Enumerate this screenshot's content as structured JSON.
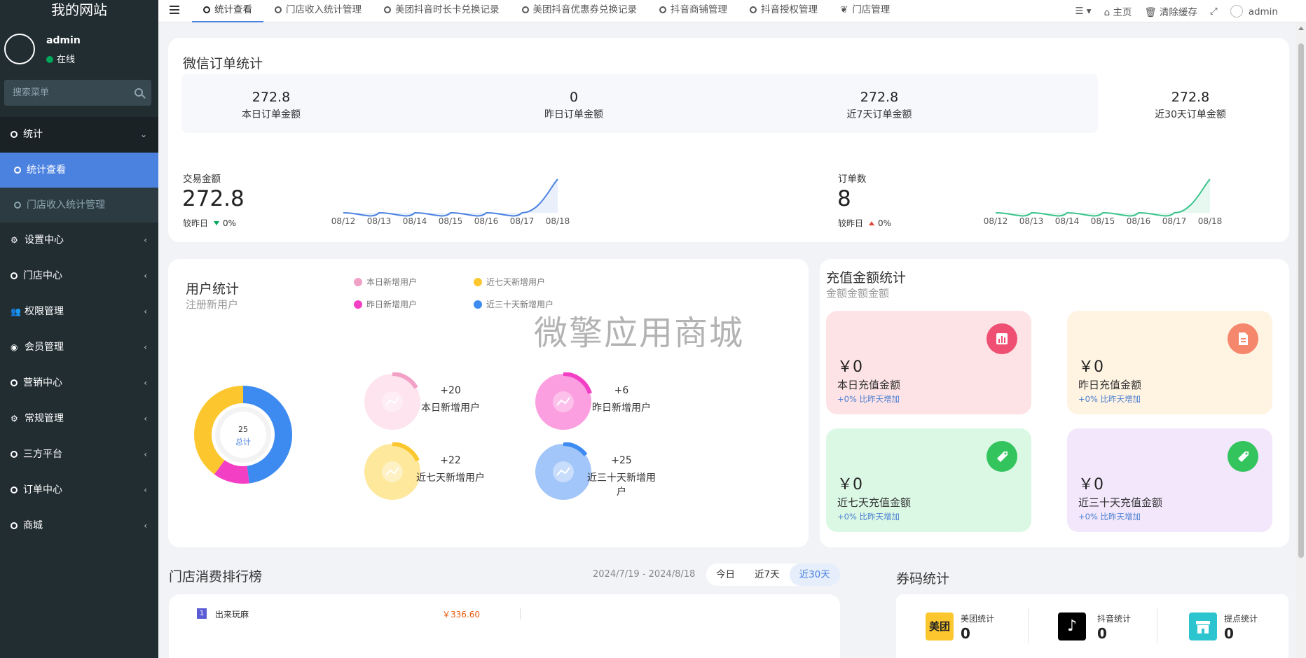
{
  "site": {
    "title": "我的网站"
  },
  "user": {
    "name": "admin",
    "status": "在线"
  },
  "search": {
    "placeholder": "搜索菜单"
  },
  "menu": {
    "stats": "统计",
    "stats_view": "统计查看",
    "store_income": "门店收入统计管理",
    "settings": "设置中心",
    "store_center": "门店中心",
    "permissions": "权限管理",
    "members": "会员管理",
    "marketing": "营销中心",
    "general": "常规管理",
    "third_party": "三方平台",
    "orders": "订单中心",
    "mall": "商城"
  },
  "tabs": [
    "统计查看",
    "门店收入统计管理",
    "美团抖音时长卡兑换记录",
    "美团抖音优惠券兑换记录",
    "抖音商铺管理",
    "抖音授权管理",
    "门店管理"
  ],
  "navbar": {
    "home": "主页",
    "clear_cache": "清除缓存",
    "user": "admin"
  },
  "wechat": {
    "title": "微信订单统计",
    "stats": [
      {
        "value": "272.8",
        "label": "本日订单金额"
      },
      {
        "value": "0",
        "label": "昨日订单金额"
      },
      {
        "value": "272.8",
        "label": "近7天订单金额"
      },
      {
        "value": "272.8",
        "label": "近30天订单金额"
      }
    ],
    "amount": {
      "label": "交易金额",
      "value": "272.8",
      "compare_label": "较昨日",
      "compare_value": "0%"
    },
    "orders": {
      "label": "订单数",
      "value": "8",
      "compare_label": "较昨日",
      "compare_value": "0%"
    }
  },
  "chart_data": [
    {
      "type": "area",
      "x": [
        "08/12",
        "08/13",
        "08/14",
        "08/15",
        "08/16",
        "08/17",
        "08/18"
      ],
      "series": [
        {
          "name": "交易金额",
          "values": [
            0,
            0,
            0,
            0,
            0,
            0,
            272.8
          ]
        }
      ],
      "color": "#4b82e0"
    },
    {
      "type": "area",
      "x": [
        "08/12",
        "08/13",
        "08/14",
        "08/15",
        "08/16",
        "08/17",
        "08/18"
      ],
      "series": [
        {
          "name": "订单数",
          "values": [
            0,
            0,
            0,
            0,
            0,
            0,
            8
          ]
        }
      ],
      "color": "#3cc48c"
    },
    {
      "type": "pie",
      "categories": [
        "近三十天新增用户",
        "昨日新增用户",
        "近七天新增用户"
      ],
      "values": [
        12,
        3,
        10
      ],
      "colors": [
        "#3d8bf0",
        "#f23fc4",
        "#fcc72e"
      ],
      "center_value": "25",
      "center_label": "总计"
    }
  ],
  "users": {
    "title": "用户统计",
    "subtitle": "注册新用户",
    "legend": [
      {
        "label": "本日新增用户",
        "color": "#f2a1c6"
      },
      {
        "label": "近七天新增用户",
        "color": "#fcc72e"
      },
      {
        "label": "昨日新增用户",
        "color": "#f23fc4"
      },
      {
        "label": "近三十天新增用户",
        "color": "#3d8bf0"
      }
    ],
    "items": [
      {
        "value": "+20",
        "label": "本日新增用户"
      },
      {
        "value": "+6",
        "label": "昨日新增用户"
      },
      {
        "value": "+22",
        "label": "近七天新增用户"
      },
      {
        "value": "+25",
        "label": "近三十天新增用户"
      }
    ],
    "watermark": "微擎应用商城"
  },
  "recharge": {
    "title": "充值金额统计",
    "subtitle": "金额金额金额",
    "cards": [
      {
        "value": "￥0",
        "label": "本日充值金额",
        "delta": "+0% 比昨天增加"
      },
      {
        "value": "￥0",
        "label": "昨日充值金额",
        "delta": "+0% 比昨天增加"
      },
      {
        "value": "￥0",
        "label": "近七天充值金额",
        "delta": "+0% 比昨天增加"
      },
      {
        "value": "￥0",
        "label": "近三十天充值金额",
        "delta": "+0% 比昨天增加"
      }
    ]
  },
  "ranking": {
    "title": "门店消费排行榜",
    "date_range": "2024/7/19 - 2024/8/18",
    "filters": [
      "今日",
      "近7天",
      "近30天"
    ],
    "rows": [
      {
        "rank": "1",
        "name": "出来玩麻",
        "amount": "￥336.60"
      }
    ]
  },
  "coupons": {
    "title": "券码统计",
    "items": [
      {
        "icon_text": "美团",
        "label": "美团统计",
        "value": "0"
      },
      {
        "icon_text": "♪",
        "label": "抖音统计",
        "value": "0"
      },
      {
        "icon_text": "",
        "label": "提点统计",
        "value": "0"
      }
    ]
  }
}
